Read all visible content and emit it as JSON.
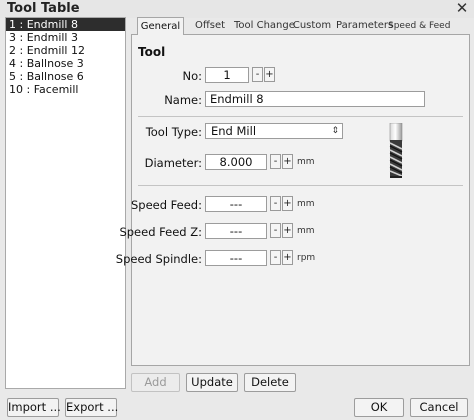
{
  "window": {
    "title": "Tool Table",
    "close_glyph": "✕"
  },
  "tool_list": {
    "items": [
      {
        "label": "1 : Endmill 8",
        "selected": true
      },
      {
        "label": "3 : Endmill 3"
      },
      {
        "label": "2 : Endmill 12"
      },
      {
        "label": "4 : Ballnose 3"
      },
      {
        "label": "5 : Ballnose 6"
      },
      {
        "label": "10 : Facemill"
      }
    ]
  },
  "tabs": [
    {
      "label": "General",
      "active": true
    },
    {
      "label": "Offset"
    },
    {
      "label": "Tool Change"
    },
    {
      "label": "Custom"
    },
    {
      "label": "Parameters"
    },
    {
      "label": "Speed & Feed"
    }
  ],
  "tool_section": {
    "title": "Tool",
    "no_label": "No:",
    "no_value": "1",
    "name_label": "Name:",
    "name_value": "Endmill 8"
  },
  "geometry_section": {
    "type_label": "Tool Type:",
    "type_value": "End Mill",
    "diameter_label": "Diameter:",
    "diameter_value": "8.000",
    "diameter_unit": "mm",
    "image_icon": "endmill-tool-icon"
  },
  "speed_section": {
    "feed_label": "Speed Feed:",
    "feed_value": "---",
    "feed_unit": "mm",
    "feed_z_label": "Speed Feed Z:",
    "feed_z_value": "---",
    "feed_z_unit": "mm",
    "spindle_label": "Speed Spindle:",
    "spindle_value": "---",
    "spindle_unit": "rpm"
  },
  "spin": {
    "minus": "-",
    "plus": "+"
  },
  "actions": {
    "add": "Add",
    "update": "Update",
    "delete": "Delete"
  },
  "footer": {
    "import": "Import ...",
    "export": "Export ...",
    "ok": "OK",
    "cancel": "Cancel"
  }
}
